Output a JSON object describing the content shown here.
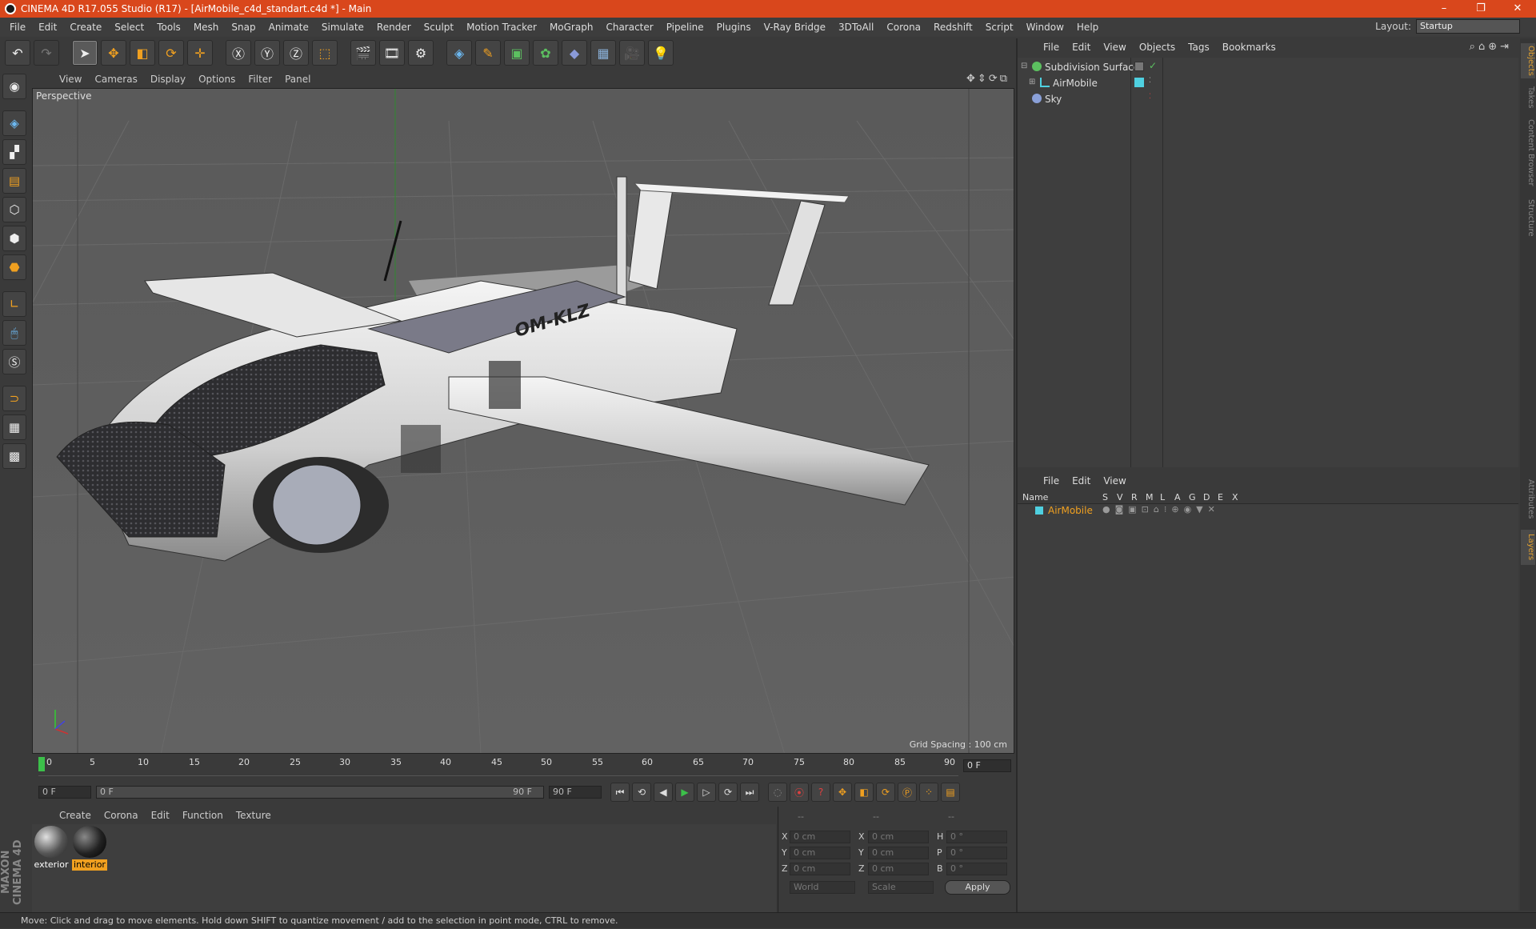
{
  "window": {
    "title": "CINEMA 4D R17.055 Studio (R17) - [AirMobile_c4d_standart.c4d *] - Main",
    "controls": [
      "–",
      "❐",
      "✕"
    ]
  },
  "menubar": {
    "items": [
      "File",
      "Edit",
      "Create",
      "Select",
      "Tools",
      "Mesh",
      "Snap",
      "Animate",
      "Simulate",
      "Render",
      "Sculpt",
      "Motion Tracker",
      "MoGraph",
      "Character",
      "Pipeline",
      "Plugins",
      "V-Ray Bridge",
      "3DToAll",
      "Corona",
      "Redshift",
      "Script",
      "Window",
      "Help"
    ],
    "layout_label": "Layout:",
    "layout_value": "Startup"
  },
  "viewport": {
    "menu": [
      "View",
      "Cameras",
      "Display",
      "Options",
      "Filter",
      "Panel"
    ],
    "label": "Perspective",
    "grid_spacing": "Grid Spacing : 100 cm",
    "model_registration": "OM-KLZ"
  },
  "timeline": {
    "ticks": [
      "0",
      "5",
      "10",
      "15",
      "20",
      "25",
      "30",
      "35",
      "40",
      "45",
      "50",
      "55",
      "60",
      "65",
      "70",
      "75",
      "80",
      "85",
      "90"
    ],
    "current_frame": "0 F",
    "start_field": "0 F",
    "range_start": "0 F",
    "range_end": "90 F",
    "end_field": "90 F"
  },
  "material_manager": {
    "menu": [
      "Create",
      "Corona",
      "Edit",
      "Function",
      "Texture"
    ],
    "materials": [
      {
        "name": "exterior",
        "selected": false
      },
      {
        "name": "interior",
        "selected": true
      }
    ]
  },
  "coordinates": {
    "header": [
      "--",
      "--",
      "--"
    ],
    "rows": [
      {
        "axis1": "X",
        "val1": "0 cm",
        "axis2": "X",
        "val2": "0 cm",
        "axis3": "H",
        "val3": "0 °"
      },
      {
        "axis1": "Y",
        "val1": "0 cm",
        "axis2": "Y",
        "val2": "0 cm",
        "axis3": "P",
        "val3": "0 °"
      },
      {
        "axis1": "Z",
        "val1": "0 cm",
        "axis2": "Z",
        "val2": "0 cm",
        "axis3": "B",
        "val3": "0 °"
      }
    ],
    "mode": "World",
    "scale": "Scale",
    "apply": "Apply"
  },
  "object_manager": {
    "menu": [
      "File",
      "Edit",
      "View",
      "Objects",
      "Tags",
      "Bookmarks"
    ],
    "objects": [
      {
        "name": "Subdivision Surface",
        "color": "#5cc060"
      },
      {
        "name": "AirMobile",
        "color": "#4fd0e0"
      },
      {
        "name": "Sky",
        "color": "#8aa0d8"
      }
    ]
  },
  "layer_manager": {
    "menu": [
      "File",
      "Edit",
      "View"
    ],
    "columns": [
      "Name",
      "S",
      "V",
      "R",
      "M",
      "L",
      "A",
      "G",
      "D",
      "E",
      "X"
    ],
    "layers": [
      {
        "name": "AirMobile",
        "color": "#4fd0e0"
      }
    ]
  },
  "right_tabs": [
    "Objects",
    "Takes",
    "Content Browser",
    "Structure",
    "Attributes",
    "Layers"
  ],
  "status": "Move: Click and drag to move elements. Hold down SHIFT to quantize movement / add to the selection in point mode, CTRL to remove.",
  "logo": "MAXON CINEMA 4D",
  "colors": {
    "titlebar": "#d9471c",
    "accent_orange": "#f0a020",
    "selection_cyan": "#4fd0e0"
  }
}
